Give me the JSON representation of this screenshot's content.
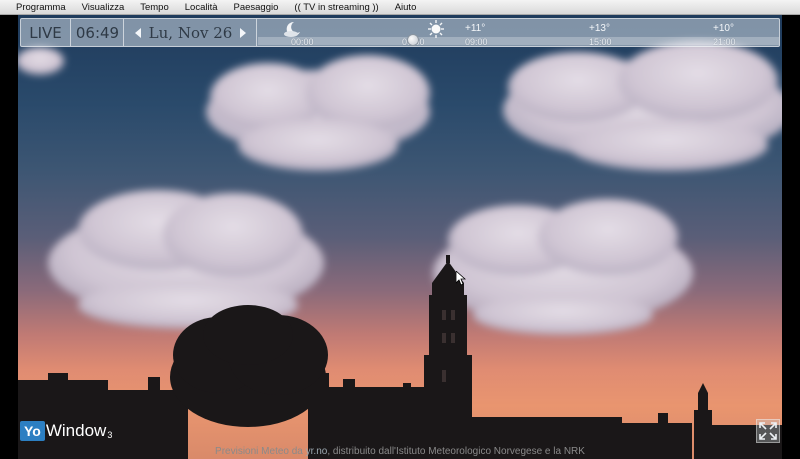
{
  "menu": {
    "items": [
      "Programma",
      "Visualizza",
      "Tempo",
      "Località",
      "Paesaggio",
      "(( TV in streaming ))",
      "Aiuto"
    ]
  },
  "toolbar": {
    "mode": "LIVE",
    "time": "06:49",
    "date": "Lu, Nov 26"
  },
  "timeline": {
    "hours": [
      "00:00",
      "06:00",
      "09:00",
      "15:00",
      "21:00"
    ],
    "temps": [
      "+11°",
      "+13°",
      "+10°"
    ],
    "icons": [
      "moon-icon",
      "sun-icon"
    ],
    "current_position_fraction": 0.3
  },
  "logo": {
    "yo": "Yo",
    "window": "Window",
    "version": "3"
  },
  "credits": {
    "prefix": "Previsioni Meteo da ",
    "source": "yr.no",
    "suffix": ", distribuito dall'Istituto Meteorologico Norvegese e la NRK"
  },
  "colors": {
    "sky_top": "#1f3b5c",
    "sky_bottom": "#e9956f",
    "logo_blue": "#2c7fc2"
  }
}
